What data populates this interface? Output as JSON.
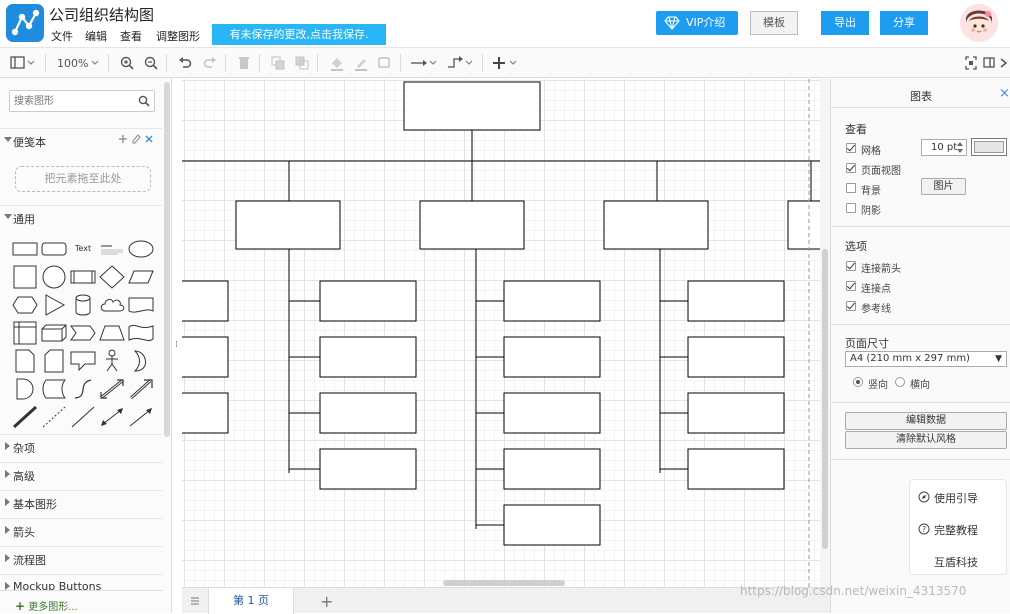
{
  "header": {
    "title": "公司组织结构图",
    "menu": [
      "文件",
      "编辑",
      "查看",
      "调整图形"
    ],
    "unsaved_notice": "有未保存的更改,点击我保存.",
    "vip_label": "VIP介绍",
    "template_label": "模板",
    "export_label": "导出",
    "share_label": "分享"
  },
  "toolbar": {
    "zoom": "100%"
  },
  "sidebar": {
    "search_placeholder": "搜索图形",
    "scratchpad_title": "便笺本",
    "drop_hint": "把元素拖至此处",
    "general_title": "通用",
    "text_shape_label": "Text",
    "categories": [
      "杂项",
      "高级",
      "基本图形",
      "箭头",
      "流程图",
      "Mockup Buttons"
    ],
    "more_shapes": "更多图形..."
  },
  "pages": {
    "current_tab": "第 1 页"
  },
  "panel": {
    "title": "图表",
    "view_title": "查看",
    "grid_label": "网格",
    "grid_size": "10 pt",
    "page_view_label": "页面视图",
    "background_label": "背景",
    "image_button": "图片",
    "shadow_label": "阴影",
    "options_title": "选项",
    "connection_arrows_label": "连接箭头",
    "connection_points_label": "连接点",
    "guides_label": "参考线",
    "paper_size_title": "页面尺寸",
    "paper_size_value": "A4 (210 mm x 297 mm)",
    "portrait_label": "竖向",
    "landscape_label": "横向",
    "edit_data_button": "编辑数据",
    "clear_style_button": "清除默认风格",
    "help": [
      "使用引导",
      "完整教程",
      "互盾科技"
    ],
    "checkbox_state": {
      "grid": true,
      "page_view": true,
      "background": false,
      "shadow": false,
      "connection_arrows": true,
      "connection_points": true,
      "guides": true
    },
    "orientation": "portrait"
  },
  "watermark": "https://blog.csdn.net/weixin_4313570",
  "colors": {
    "accent": "#1e9cf0",
    "notice_bg": "#29b6f6",
    "logo_bg": "#1f8ce0",
    "page_tab_text": "#1d5aa3"
  },
  "icons": [
    "logo-icon",
    "diamond-icon",
    "format-panel-icon",
    "zoom-in-icon",
    "zoom-out-icon",
    "undo-icon",
    "redo-icon",
    "delete-icon",
    "to-front-icon",
    "to-back-icon",
    "fill-color-icon",
    "line-color-icon",
    "shadow-icon",
    "connection-icon",
    "waypoint-icon",
    "insert-icon",
    "fullscreen-icon",
    "split-view-icon",
    "collapse-icon",
    "search-icon",
    "close-icon",
    "help-icon"
  ]
}
